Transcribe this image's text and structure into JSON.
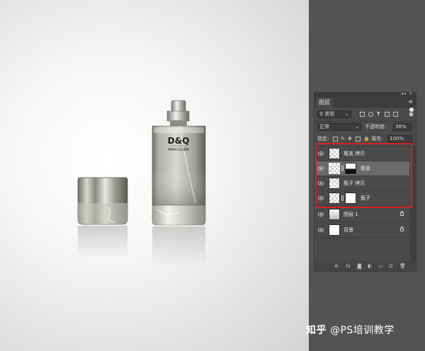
{
  "canvas": {
    "bottle": {
      "brand": "D&Q",
      "subtitle": "MASCULINE"
    }
  },
  "layers_panel": {
    "tab_label": "图层",
    "filter": {
      "kind_label": "类型"
    },
    "blend_mode": "正常",
    "opacity_label": "不透明度:",
    "opacity_value": "36%",
    "lock_label": "锁定:",
    "fill_label": "填充:",
    "fill_value": "100%",
    "layers": [
      {
        "name": "瓶盖 拷贝",
        "visible": true,
        "selected": false
      },
      {
        "name": "瓶盖",
        "visible": true,
        "selected": true,
        "has_mask": true
      },
      {
        "name": "瓶子 拷贝",
        "visible": true,
        "selected": false
      },
      {
        "name": "瓶子",
        "visible": true,
        "selected": false,
        "has_mask": true
      },
      {
        "name": "图层 1",
        "visible": true,
        "selected": false,
        "locked": true
      },
      {
        "name": "背景",
        "visible": true,
        "selected": false,
        "locked": true
      }
    ],
    "footer_icons": [
      "link-icon",
      "fx-icon",
      "mask-icon",
      "adjustment-icon",
      "folder-icon",
      "new-layer-icon",
      "trash-icon"
    ]
  },
  "watermark": {
    "site": "知乎",
    "author": "@PS培训教学"
  },
  "colors": {
    "highlight": "#d42222",
    "panel": "#4a4a4a",
    "workspace": "#535353"
  }
}
